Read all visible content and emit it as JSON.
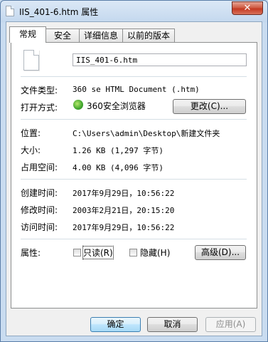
{
  "window": {
    "title": "IIS_401-6.htm 属性",
    "close_glyph": "✕"
  },
  "tabs": [
    "常规",
    "安全",
    "详细信息",
    "以前的版本"
  ],
  "general": {
    "file_name": "IIS_401-6.htm",
    "type_label": "文件类型:",
    "type_value": "360 se HTML Document (.htm)",
    "opens_label": "打开方式:",
    "opens_value": "360安全浏览器",
    "change_button": "更改(C)...",
    "location_label": "位置:",
    "location_value": "C:\\Users\\admin\\Desktop\\新建文件夹",
    "size_label": "大小:",
    "size_value": "1.26 KB (1,297 字节)",
    "disk_label": "占用空间:",
    "disk_value": "4.00 KB (4,096 字节)",
    "created_label": "创建时间:",
    "created_value": "2017年9月29日，10:56:22",
    "modified_label": "修改时间:",
    "modified_value": "2003年2月21日，20:15:20",
    "accessed_label": "访问时间:",
    "accessed_value": "2017年9月29日，10:56:22",
    "attributes_label": "属性:",
    "readonly_label": "只读(R)",
    "hidden_label": "隐藏(H)",
    "advanced_button": "高级(D)..."
  },
  "buttons": {
    "ok": "确定",
    "cancel": "取消",
    "apply": "应用(A)"
  }
}
